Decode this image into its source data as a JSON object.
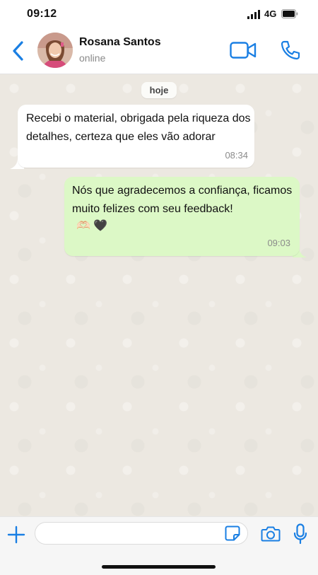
{
  "status_bar": {
    "time": "09:12",
    "network": "4G"
  },
  "header": {
    "contact_name": "Rosana Santos",
    "contact_status": "online",
    "icons": {
      "back": "chevron-left-icon",
      "video": "video-camera-icon",
      "call": "phone-icon"
    }
  },
  "chat": {
    "date_label": "hoje",
    "messages": [
      {
        "direction": "incoming",
        "text": "Recebi o material, obrigada pela riqueza dos detalhes, certeza que eles vão adorar",
        "time": "08:34"
      },
      {
        "direction": "outgoing",
        "text": "Nós que agradecemos a confiança, ficamos muito felizes com seu feedback!",
        "emojis": "🫶🏻 🖤",
        "time": "09:03"
      }
    ]
  },
  "input_bar": {
    "placeholder": "",
    "icons": {
      "attach": "plus-icon",
      "sticker": "sticker-icon",
      "camera": "camera-icon",
      "mic": "microphone-icon"
    }
  },
  "colors": {
    "accent": "#1a7fe3",
    "incoming_bubble": "#ffffff",
    "outgoing_bubble": "#dcf8c6",
    "chat_background": "#ece8e1"
  }
}
